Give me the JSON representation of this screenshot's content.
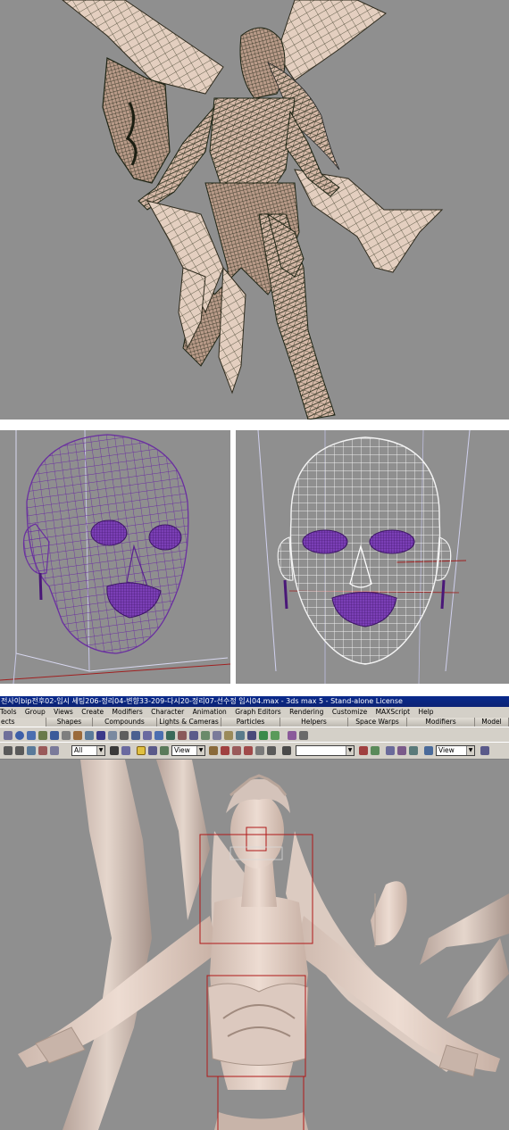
{
  "max_window": {
    "title": "전사이bip전후02-임시 세팅206-정리04-변향33-209-다시20-정리07-선수정 임시04.max - 3ds max 5 - Stand-alone License",
    "menus": [
      "Tools",
      "Group",
      "Views",
      "Create",
      "Modifiers",
      "Character",
      "Animation",
      "Graph Editors",
      "Rendering",
      "Customize",
      "MAXScript",
      "Help"
    ],
    "tabs": [
      "ects",
      "Shapes",
      "Compounds",
      "Lights & Cameras",
      "Particles",
      "Helpers",
      "Space Warps",
      "Modifiers",
      "Model"
    ],
    "selection_filter": "All",
    "coord_system": "View",
    "named_selection": "",
    "view_dropdown": "View"
  },
  "colors": {
    "viewport_bg": "#8f8f8f",
    "wire_dark": "#2f3a1c",
    "wire_purple": "#6a2fa0",
    "wire_white": "#f2f2f2",
    "skin": "#d9c2b4",
    "selection_box": "#b01818",
    "title_bar": "#0a2a8c",
    "ui_gray": "#d4d0c8"
  }
}
